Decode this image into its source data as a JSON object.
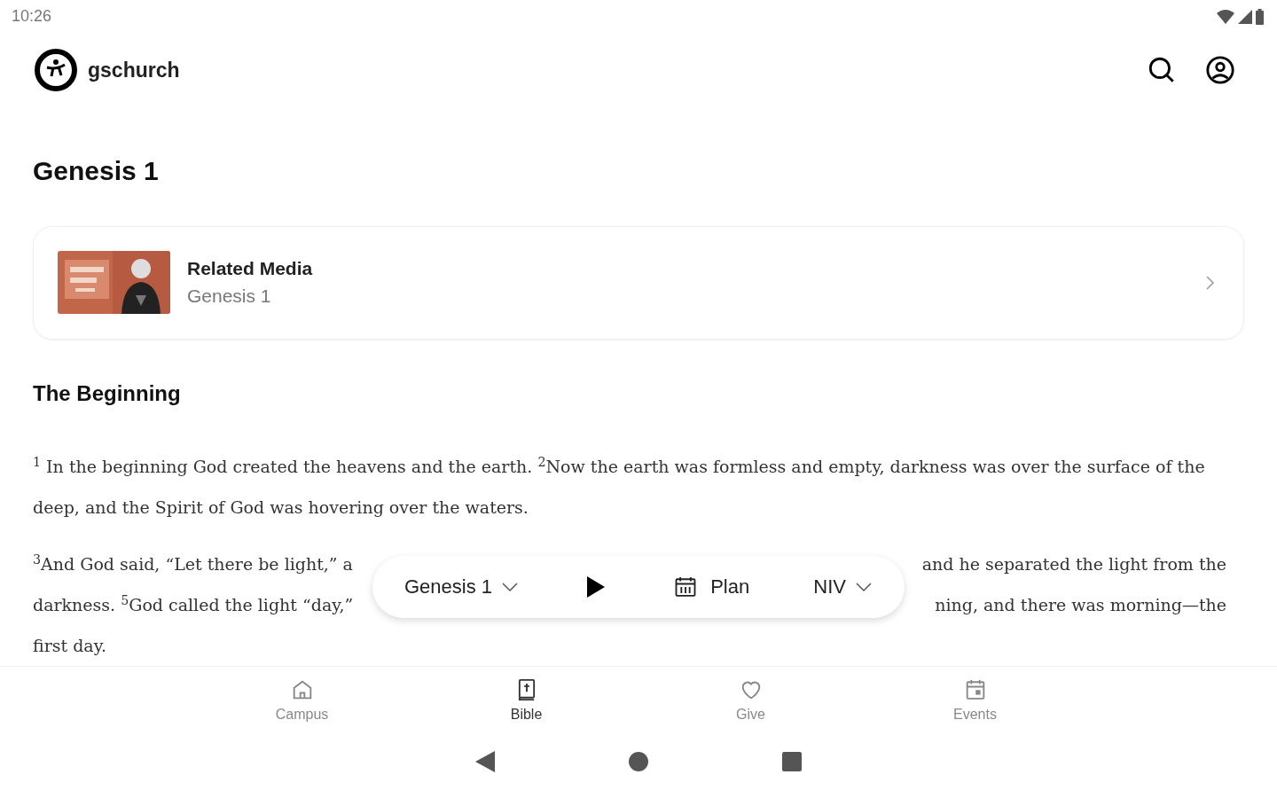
{
  "status_bar": {
    "time": "10:26"
  },
  "header": {
    "brand": "gschurch"
  },
  "page_title": "Genesis 1",
  "related_media": {
    "title": "Related Media",
    "subtitle": "Genesis 1"
  },
  "section_heading": "The Beginning",
  "paragraphs": [
    {
      "kind": "flow",
      "text": "$^{1}$ In the beginning God created the heavens and the earth. $^{2}$Now the earth was formless and empty, darkness was over the surface of the deep, and the Spirit of God was hovering over the waters."
    },
    {
      "kind": "lines",
      "lines": [
        {
          "left": "$^{3}$And God said, “Let there be light,” a",
          "right": "and he separated the light from the"
        },
        {
          "left": "darkness. $^{5}$God called the light “day,”",
          "right": "ning, and there was morning—the"
        },
        {
          "left": "first day."
        }
      ]
    }
  ],
  "reader_bar": {
    "chapter": "Genesis 1",
    "plan": "Plan",
    "version": "NIV"
  },
  "bottom_nav": [
    {
      "label": "Campus",
      "kind": "home",
      "selected": false
    },
    {
      "label": "Bible",
      "kind": "bible",
      "selected": true
    },
    {
      "label": "Give",
      "kind": "heart",
      "selected": false
    },
    {
      "label": "Events",
      "kind": "calendar",
      "selected": false
    }
  ]
}
